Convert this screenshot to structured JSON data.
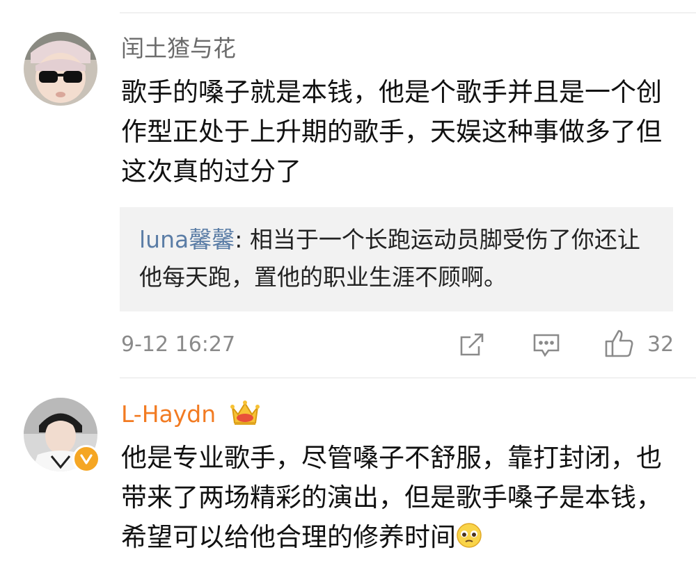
{
  "comments": [
    {
      "username": "闰土猹与花",
      "text": "歌手的嗓子就是本钱，他是个歌手并且是一个创作型正处于上升期的歌手，天娱这种事做多了但这次真的过分了",
      "reply": {
        "user": "luna馨馨",
        "separator": ":",
        "text": " 相当于一个长跑运动员脚受伤了你还让他每天跑，置他的职业生涯不顾啊。"
      },
      "timestamp": "9-12 16:27",
      "like_count": "32",
      "icons": [
        "share-icon",
        "comment-icon",
        "like-icon"
      ]
    },
    {
      "username": "L-Haydn",
      "text": "他是专业歌手，尽管嗓子不舒服，靠打封闭，也带来了两场精彩的演出，但是歌手嗓子是本钱，希望可以给他合理的修养时间",
      "badges": [
        "crown-icon",
        "verified-icon",
        "pleading-emoji-icon"
      ]
    }
  ],
  "colors": {
    "username_primary": "#6b6b6b",
    "username_vip": "#f27b22",
    "reply_user": "#5b7da6",
    "meta_gray": "#8a8a8a",
    "reply_bg": "#f2f2f2"
  }
}
